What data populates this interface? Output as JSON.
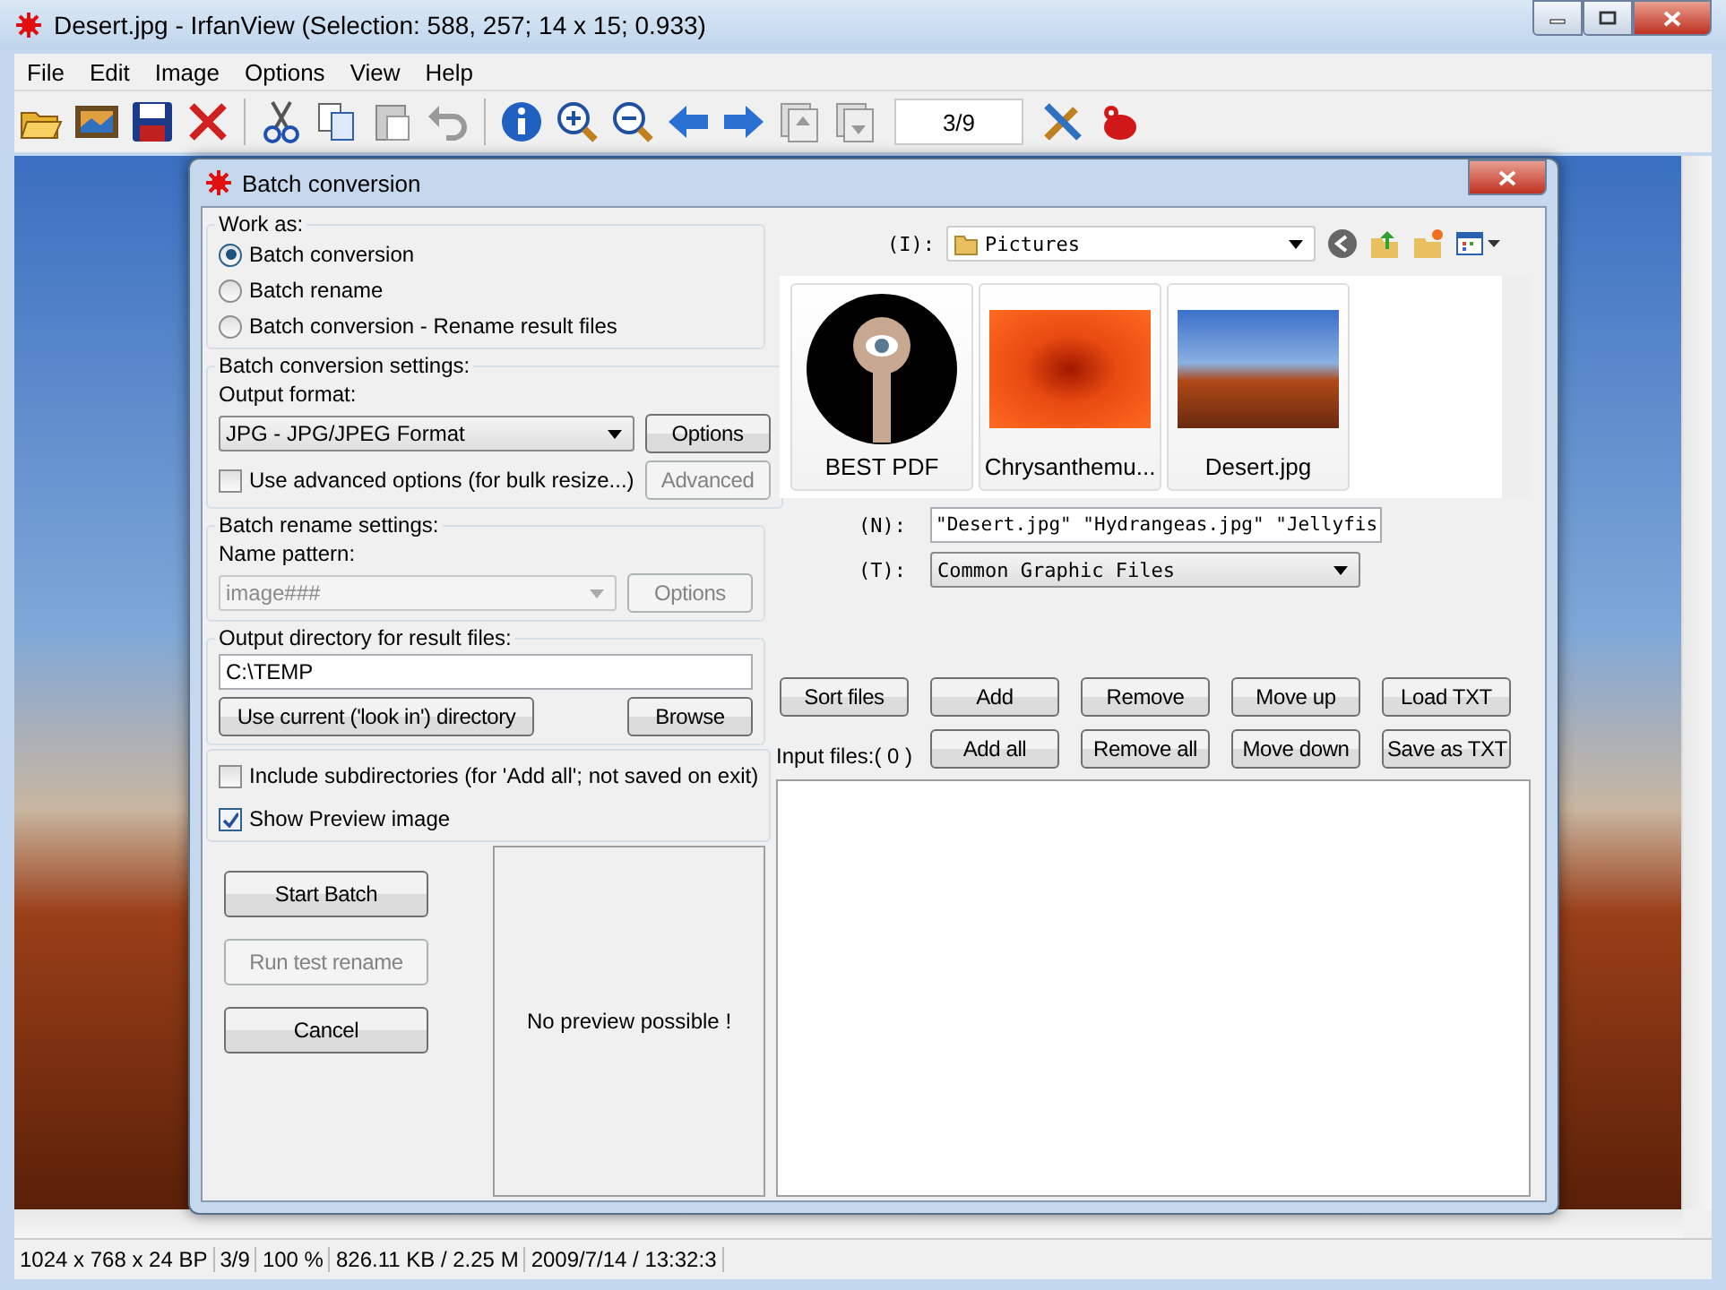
{
  "window": {
    "title": "Desert.jpg - IrfanView (Selection: 588, 257; 14 x 15; 0.933)"
  },
  "menu": [
    {
      "label": "File"
    },
    {
      "label": "Edit"
    },
    {
      "label": "Image"
    },
    {
      "label": "Options"
    },
    {
      "label": "View"
    },
    {
      "label": "Help"
    }
  ],
  "toolbar": {
    "page": "3/9"
  },
  "status_bar": [
    {
      "text": "1024 x 768 x 24 BP"
    },
    {
      "text": "3/9"
    },
    {
      "text": "100 %"
    },
    {
      "text": "826.11 KB / 2.25 M"
    },
    {
      "text": "2009/7/14 / 13:32:3"
    }
  ],
  "dialog": {
    "title": "Batch conversion",
    "work_as": {
      "label": "Work as:",
      "options": [
        {
          "label": "Batch conversion",
          "selected": true
        },
        {
          "label": "Batch rename",
          "selected": false
        },
        {
          "label": "Batch conversion - Rename result files",
          "selected": false
        }
      ]
    },
    "conversion_settings": {
      "label": "Batch conversion settings:",
      "format_label": "Output format:",
      "format_value": "JPG - JPG/JPEG Format",
      "options_button": {
        "label": "Options",
        "disabled": false
      },
      "advanced_checkbox": {
        "label": "Use advanced options (for bulk resize...)",
        "checked": false
      },
      "advanced_button": {
        "label": "Advanced",
        "disabled": true
      }
    },
    "rename_settings": {
      "label": "Batch rename settings:",
      "pattern_label": "Name pattern:",
      "pattern_value": "image###",
      "disabled": true,
      "options_button": {
        "label": "Options",
        "disabled": true
      }
    },
    "output_dir": {
      "label": "Output directory for result files:",
      "value": "C:\\TEMP",
      "use_current_button": {
        "label": "Use current ('look in') directory",
        "disabled": false
      },
      "browse_button": {
        "label": "Browse",
        "disabled": false
      }
    },
    "flags": [
      {
        "label": "Include subdirectories (for 'Add all'; not saved on exit)",
        "checked": false
      },
      {
        "label": "Show Preview image",
        "checked": true
      }
    ],
    "actions": [
      {
        "label": "Start Batch",
        "disabled": false
      },
      {
        "label": "Run test rename",
        "disabled": true
      },
      {
        "label": "Cancel",
        "disabled": false
      }
    ],
    "preview_text": "No preview possible !",
    "look_in": {
      "label": "(I):",
      "value": "Pictures"
    },
    "thumbnails": [
      {
        "caption": "BEST PDF",
        "kind": "keyhole"
      },
      {
        "caption": "Chrysanthemu...",
        "kind": "flower"
      },
      {
        "caption": "Desert.jpg",
        "kind": "desert"
      }
    ],
    "file_name": {
      "label": "(N):",
      "value": "\"Desert.jpg\" \"Hydrangeas.jpg\" \"Jellyfis"
    },
    "file_type": {
      "label": "(T):",
      "value": "Common Graphic Files"
    },
    "file_buttons_row1": [
      {
        "label": "Sort files"
      },
      {
        "label": "Add"
      },
      {
        "label": "Remove"
      },
      {
        "label": "Move up"
      },
      {
        "label": "Load TXT"
      }
    ],
    "input_files_label": "Input files:( 0 )",
    "file_buttons_row2": [
      {
        "label": "Add all"
      },
      {
        "label": "Remove all"
      },
      {
        "label": "Move down"
      },
      {
        "label": "Save as TXT"
      }
    ]
  }
}
